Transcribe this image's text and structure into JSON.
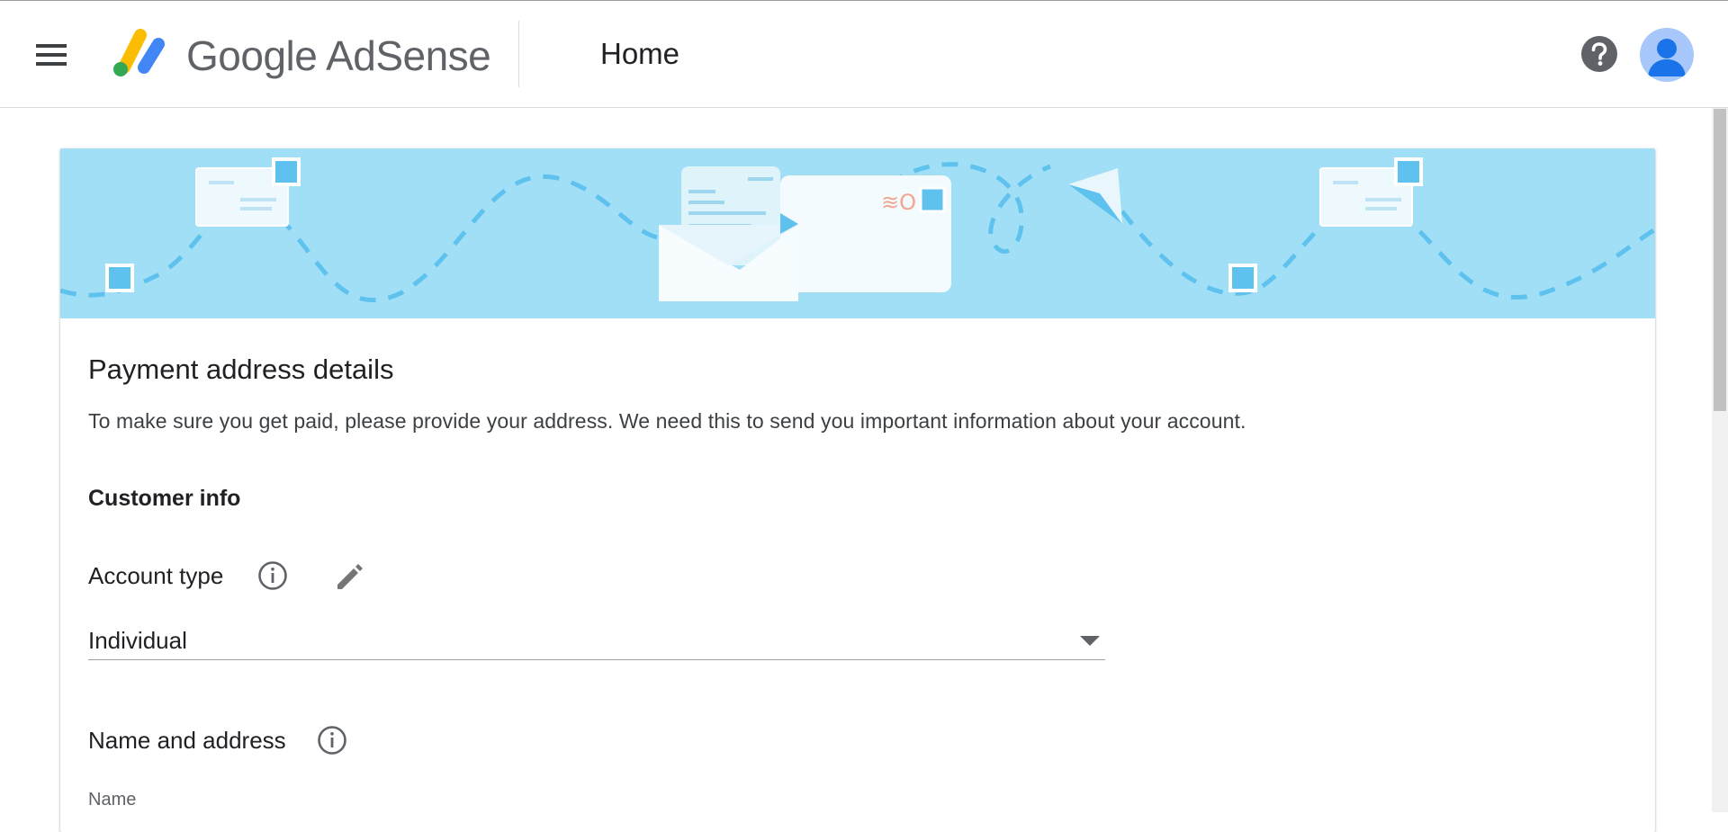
{
  "header": {
    "brand": "Google AdSense",
    "page_title": "Home"
  },
  "card": {
    "title": "Payment address details",
    "description": "To make sure you get paid, please provide your address. We need this to send you important information about your account.",
    "section_heading": "Customer info",
    "account_type": {
      "label": "Account type",
      "value": "Individual"
    },
    "name_and_address": {
      "label": "Name and address",
      "name_label": "Name"
    }
  },
  "icons": {
    "menu": "menu-icon",
    "help": "help-icon",
    "avatar": "account-avatar",
    "info": "info-icon",
    "edit": "pencil-icon",
    "dropdown": "dropdown-arrow-icon"
  },
  "colors": {
    "banner": "#a1dff6",
    "logo_yellow": "#fbbc04",
    "logo_blue": "#4285f4",
    "logo_green": "#34a853"
  }
}
